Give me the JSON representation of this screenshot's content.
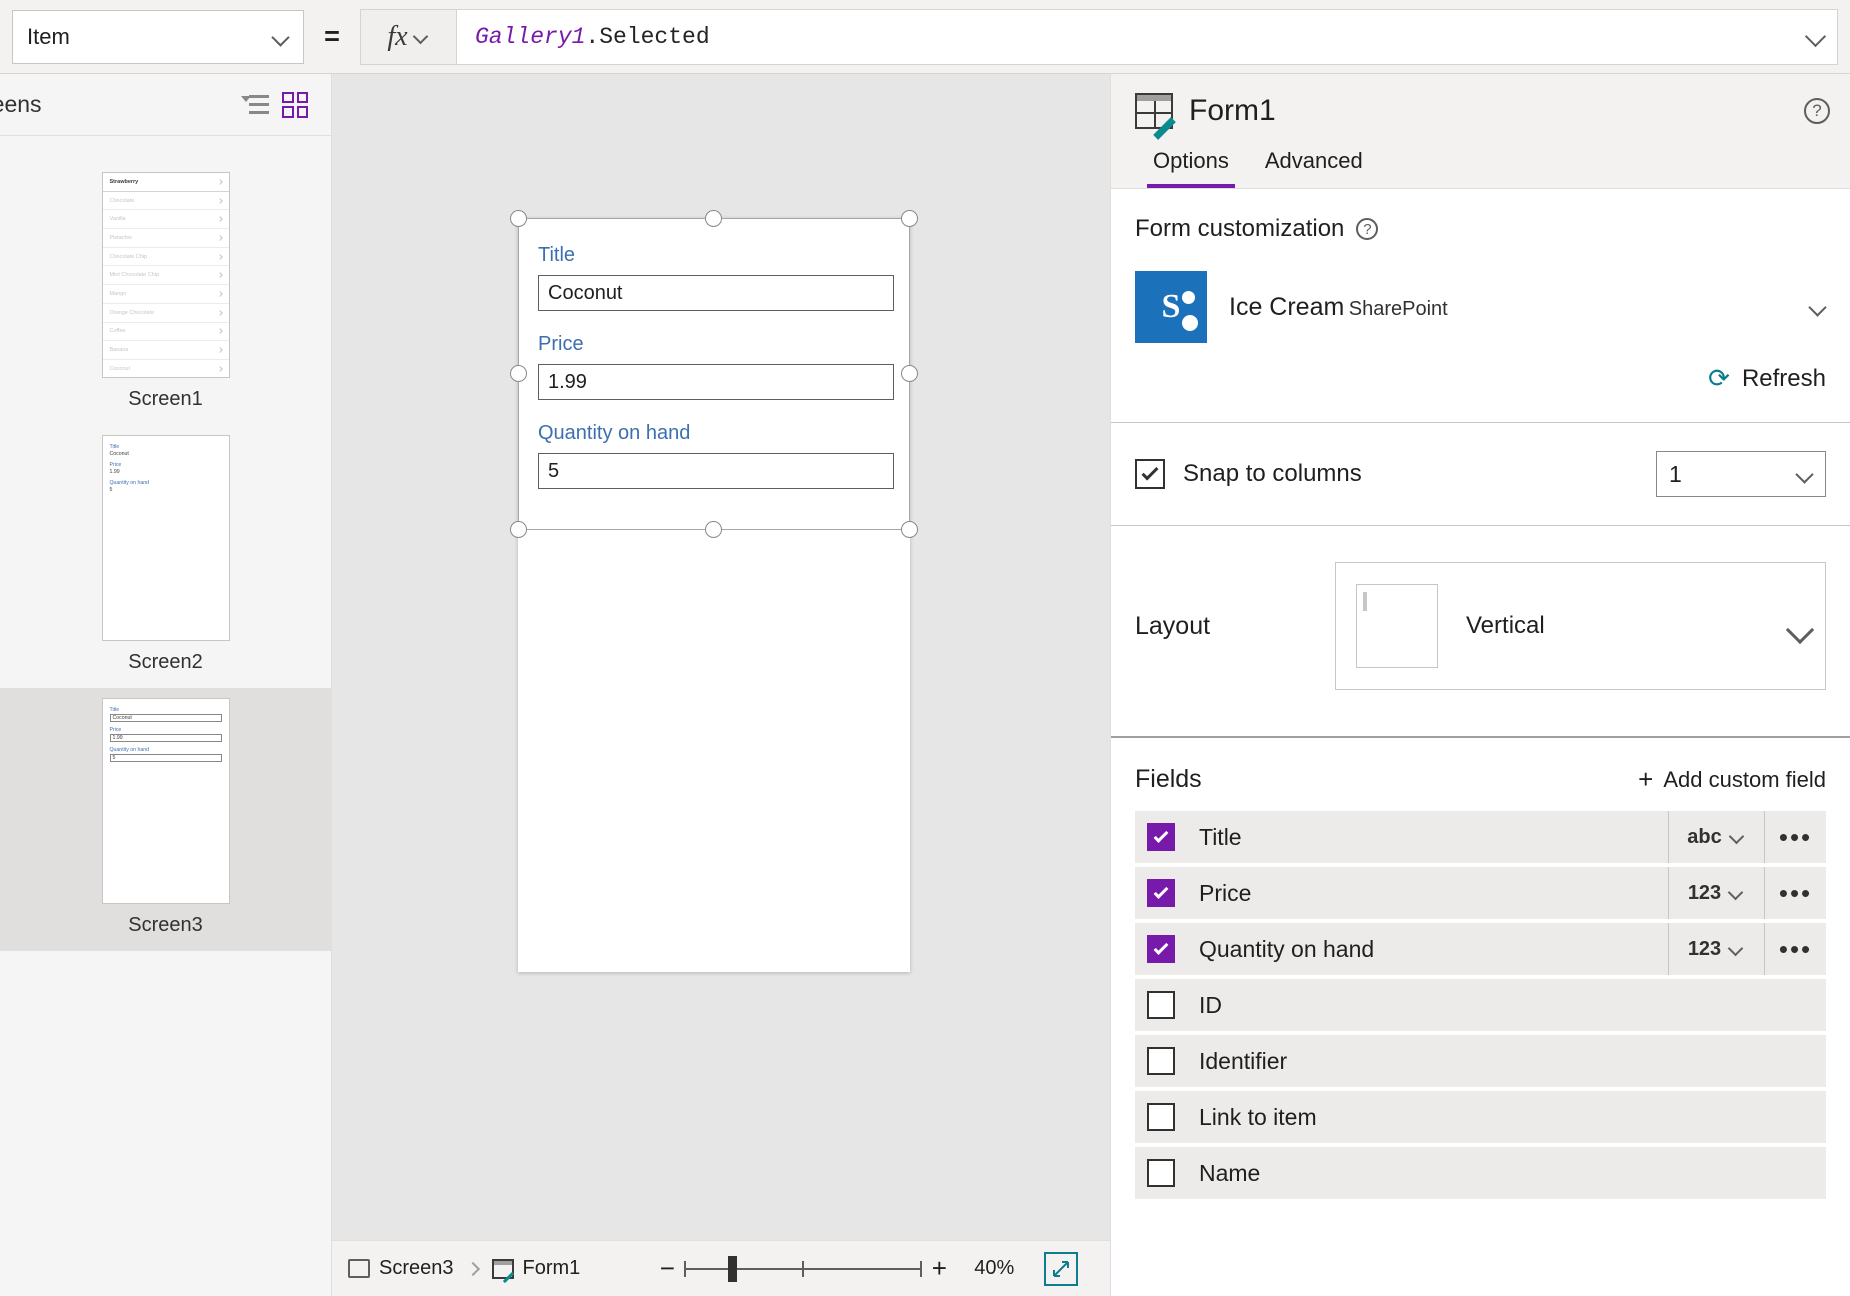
{
  "formula_bar": {
    "property_selected": "Item",
    "equals": "=",
    "fx_label": "fx",
    "formula_control": "Gallery1",
    "formula_property": ".Selected"
  },
  "left_pane": {
    "title": "reens",
    "tree_view_icon": "tree-view-icon",
    "grid_view_icon": "grid-view-icon",
    "screens": [
      {
        "caption": "Screen1",
        "selected": false,
        "gallery_items": [
          "Strawberry",
          "Chocolate",
          "Vanilla",
          "Pistachio",
          "Chocolate Chip",
          "Mint Chocolate Chip",
          "Mango",
          "Orange Chocolate",
          "Coffee",
          "Banana",
          "Coconut"
        ]
      },
      {
        "caption": "Screen2",
        "selected": false,
        "form_preview": {
          "labels": [
            "Title",
            "Price",
            "Quantity on hand"
          ],
          "values": [
            "Coconut",
            "1.99",
            "5"
          ]
        }
      },
      {
        "caption": "Screen3",
        "selected": true,
        "form_preview": {
          "labels": [
            "Title",
            "Price",
            "Quantity on hand"
          ],
          "values": [
            "Coconut",
            "1.99",
            "5"
          ]
        }
      }
    ]
  },
  "canvas": {
    "form_fields": [
      {
        "label": "Title",
        "value": "Coconut"
      },
      {
        "label": "Price",
        "value": "1.99"
      },
      {
        "label": "Quantity on hand",
        "value": "5"
      }
    ]
  },
  "status_bar": {
    "breadcrumb_screen": "Screen3",
    "breadcrumb_control": "Form1",
    "zoom_out": "−",
    "zoom_in": "+",
    "zoom_value": "40%",
    "fit_icon": "fit-to-screen-icon"
  },
  "right_pane": {
    "title": "Form1",
    "help_icon": "?",
    "tabs": [
      {
        "label": "Options",
        "active": true
      },
      {
        "label": "Advanced",
        "active": false
      }
    ],
    "form_customization": {
      "section_title": "Form customization",
      "help": "?",
      "data_source_name": "Ice Cream",
      "data_source_url_redacted": "",
      "data_source_type": "SharePoint",
      "refresh_label": "Refresh",
      "refresh_icon": "refresh-icon"
    },
    "snap_to_columns": {
      "label": "Snap to columns",
      "checked": true,
      "columns_value": "1"
    },
    "layout": {
      "label": "Layout",
      "value": "Vertical"
    },
    "fields": {
      "title": "Fields",
      "add_label": "Add custom field",
      "add_icon": "plus-icon",
      "rows": [
        {
          "name": "Title",
          "checked": true,
          "type": "abc",
          "has_type": true,
          "more": "•••"
        },
        {
          "name": "Price",
          "checked": true,
          "type": "123",
          "has_type": true,
          "more": "•••"
        },
        {
          "name": "Quantity on hand",
          "checked": true,
          "type": "123",
          "has_type": true,
          "more": "•••"
        },
        {
          "name": "ID",
          "checked": false,
          "type": "",
          "has_type": false,
          "more": ""
        },
        {
          "name": "Identifier",
          "checked": false,
          "type": "",
          "has_type": false,
          "more": ""
        },
        {
          "name": "Link to item",
          "checked": false,
          "type": "",
          "has_type": false,
          "more": ""
        },
        {
          "name": "Name",
          "checked": false,
          "type": "",
          "has_type": false,
          "more": ""
        }
      ]
    }
  },
  "colors": {
    "accent_purple": "#7719aa",
    "teal": "#0b7d8c",
    "field_label_blue": "#3d6fb0",
    "sharepoint_blue": "#1b72bb"
  }
}
